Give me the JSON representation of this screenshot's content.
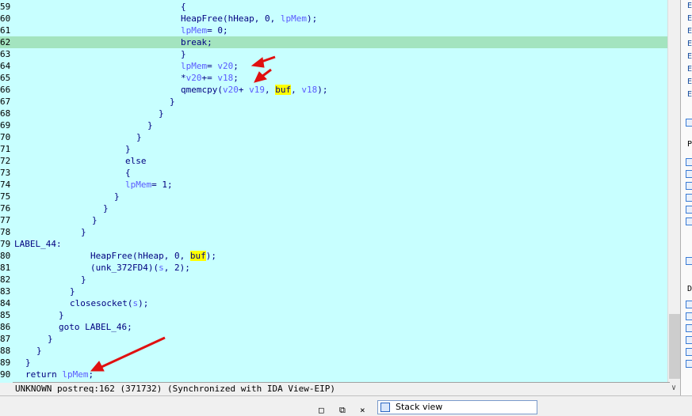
{
  "code_lines": [
    {
      "num": "59",
      "parts": [
        {
          "t": "            {",
          "c": "n"
        }
      ]
    },
    {
      "num": "60",
      "parts": [
        {
          "t": "              HeapFree(hHeap, 0, ",
          "c": "n"
        },
        {
          "t": "lpMem",
          "c": "v"
        },
        {
          "t": ");",
          "c": "n"
        }
      ]
    },
    {
      "num": "61",
      "parts": [
        {
          "t": "              ",
          "c": "n"
        },
        {
          "t": "lpMem",
          "c": "v"
        },
        {
          "t": " = 0;",
          "c": "n"
        }
      ]
    },
    {
      "num": "62",
      "parts": [
        {
          "t": "              break;",
          "c": "n"
        }
      ],
      "hl": true
    },
    {
      "num": "63",
      "parts": [
        {
          "t": "            }",
          "c": "n"
        }
      ]
    },
    {
      "num": "64",
      "parts": [
        {
          "t": "            ",
          "c": "n"
        },
        {
          "t": "lpMem",
          "c": "v"
        },
        {
          "t": " = ",
          "c": "n"
        },
        {
          "t": "v20",
          "c": "v"
        },
        {
          "t": ";",
          "c": "n"
        }
      ]
    },
    {
      "num": "65",
      "parts": [
        {
          "t": "            *",
          "c": "n"
        },
        {
          "t": "v20",
          "c": "v"
        },
        {
          "t": " += ",
          "c": "n"
        },
        {
          "t": "v18",
          "c": "v"
        },
        {
          "t": ";",
          "c": "n"
        }
      ]
    },
    {
      "num": "66",
      "parts": [
        {
          "t": "            qmemcpy(",
          "c": "n"
        },
        {
          "t": "v20",
          "c": "v"
        },
        {
          "t": " + ",
          "c": "n"
        },
        {
          "t": "v19",
          "c": "v"
        },
        {
          "t": ", ",
          "c": "n"
        },
        {
          "t": "buf",
          "c": "y"
        },
        {
          "t": ", ",
          "c": "n"
        },
        {
          "t": "v18",
          "c": "v"
        },
        {
          "t": ");",
          "c": "n"
        }
      ]
    },
    {
      "num": "67",
      "parts": [
        {
          "t": "          }",
          "c": "n"
        }
      ]
    },
    {
      "num": "68",
      "parts": [
        {
          "t": "        }",
          "c": "n"
        }
      ]
    },
    {
      "num": "69",
      "parts": [
        {
          "t": "      }",
          "c": "n"
        }
      ]
    },
    {
      "num": "70",
      "parts": [
        {
          "t": "    }",
          "c": "n"
        }
      ]
    },
    {
      "num": "71",
      "parts": [
        {
          "t": "  }",
          "c": "n"
        }
      ]
    },
    {
      "num": "72",
      "parts": [
        {
          "t": "  else",
          "c": "n"
        }
      ]
    },
    {
      "num": "73",
      "parts": [
        {
          "t": "  {",
          "c": "n"
        }
      ]
    },
    {
      "num": "74",
      "parts": [
        {
          "t": "    ",
          "c": "n"
        },
        {
          "t": "lpMem",
          "c": "v"
        },
        {
          "t": " = 1;",
          "c": "n"
        }
      ]
    },
    {
      "num": "75",
      "parts": [
        {
          "t": "  }",
          "c": "n"
        }
      ]
    },
    {
      "num": "76",
      "parts": [
        {
          "t": "}",
          "c": "n"
        }
      ]
    },
    {
      "num": "77",
      "parts": [
        {
          "t": "}",
          "c": "n"
        }
      ]
    },
    {
      "num": "78",
      "parts": [
        {
          "t": "}",
          "c": "n"
        }
      ]
    },
    {
      "num": "79",
      "parts": [
        {
          "t": "LABEL_44:",
          "c": "n"
        }
      ]
    },
    {
      "num": "80",
      "parts": [
        {
          "t": "HeapFree(hHeap, 0, ",
          "c": "n"
        },
        {
          "t": "buf",
          "c": "y"
        },
        {
          "t": ");",
          "c": "n"
        }
      ]
    },
    {
      "num": "81",
      "parts": [
        {
          "t": "(unk_372FD4)(",
          "c": "n"
        },
        {
          "t": "s",
          "c": "v"
        },
        {
          "t": ", 2);",
          "c": "n"
        }
      ]
    },
    {
      "num": "82",
      "parts": [
        {
          "t": "}",
          "c": "n"
        }
      ]
    },
    {
      "num": "83",
      "parts": [
        {
          "t": "}",
          "c": "n"
        }
      ]
    },
    {
      "num": "84",
      "parts": [
        {
          "t": "closesocket(",
          "c": "n"
        },
        {
          "t": "s",
          "c": "v"
        },
        {
          "t": ");",
          "c": "n"
        }
      ]
    },
    {
      "num": "85",
      "parts": [
        {
          "t": "}",
          "c": "n"
        }
      ]
    },
    {
      "num": "86",
      "parts": [
        {
          "t": "goto LABEL_46;",
          "c": "n"
        }
      ]
    },
    {
      "num": "87",
      "parts": [
        {
          "t": "}",
          "c": "n"
        }
      ]
    },
    {
      "num": "88",
      "parts": [
        {
          "t": "}",
          "c": "n"
        }
      ]
    },
    {
      "num": "89",
      "parts": [
        {
          "t": "}",
          "c": "n"
        }
      ]
    },
    {
      "num": "90",
      "parts": [
        {
          "t": "return ",
          "c": "n"
        },
        {
          "t": "lpMem",
          "c": "v"
        },
        {
          "t": ";",
          "c": "n"
        }
      ]
    }
  ],
  "status_text": "UNKNOWN postreq:162 (371732) (Synchronized with IDA View-EIP)",
  "right_panel_labels": [
    "E",
    "E",
    "E",
    "E",
    "E",
    "E",
    "E",
    "E"
  ],
  "right_panel_letters": [
    "P",
    "D"
  ],
  "stack_tab_label": "Stack view",
  "window_buttons": [
    "□",
    "⧉",
    "×"
  ],
  "accent_arrow_color": "#e01010"
}
